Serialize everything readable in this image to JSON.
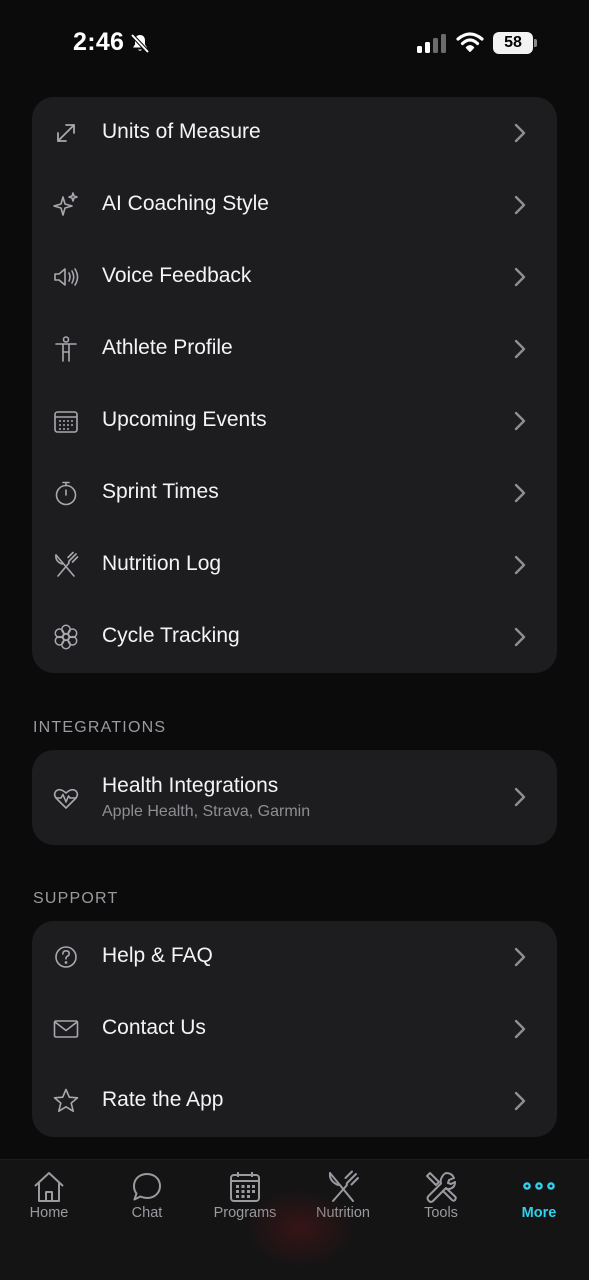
{
  "status_bar": {
    "time": "2:46",
    "battery": "58",
    "icons": [
      "bell-slash-icon",
      "cellular-signal-icon",
      "wifi-icon",
      "battery-icon"
    ]
  },
  "settings": {
    "items": [
      {
        "label": "Units of Measure",
        "icon": "arrows-diagonal-icon"
      },
      {
        "label": "AI Coaching Style",
        "icon": "sparkles-icon"
      },
      {
        "label": "Voice Feedback",
        "icon": "speaker-icon"
      },
      {
        "label": "Athlete Profile",
        "icon": "figure-icon"
      },
      {
        "label": "Upcoming Events",
        "icon": "calendar-icon"
      },
      {
        "label": "Sprint Times",
        "icon": "stopwatch-icon"
      },
      {
        "label": "Nutrition Log",
        "icon": "fork-knife-icon"
      },
      {
        "label": "Cycle Tracking",
        "icon": "flower-icon"
      }
    ]
  },
  "integrations": {
    "title": "INTEGRATIONS",
    "items": [
      {
        "label": "Health Integrations",
        "sub": "Apple Health, Strava, Garmin",
        "icon": "heart-pulse-icon"
      }
    ]
  },
  "support": {
    "title": "SUPPORT",
    "items": [
      {
        "label": "Help & FAQ",
        "icon": "question-circle-icon"
      },
      {
        "label": "Contact Us",
        "icon": "envelope-icon"
      },
      {
        "label": "Rate the App",
        "icon": "star-icon"
      }
    ]
  },
  "tab_bar": {
    "tabs": [
      {
        "label": "Home",
        "icon": "house-icon"
      },
      {
        "label": "Chat",
        "icon": "chat-bubble-icon"
      },
      {
        "label": "Programs",
        "icon": "calendar-grid-icon"
      },
      {
        "label": "Nutrition",
        "icon": "fork-knife-icon"
      },
      {
        "label": "Tools",
        "icon": "tools-icon"
      },
      {
        "label": "More",
        "icon": "ellipsis-icon"
      }
    ],
    "active": "More"
  },
  "colors": {
    "background": "#0b0b0c",
    "card": "#1d1d1f",
    "accent": "#2fd2ec",
    "secondary_text": "#8e8e93"
  }
}
